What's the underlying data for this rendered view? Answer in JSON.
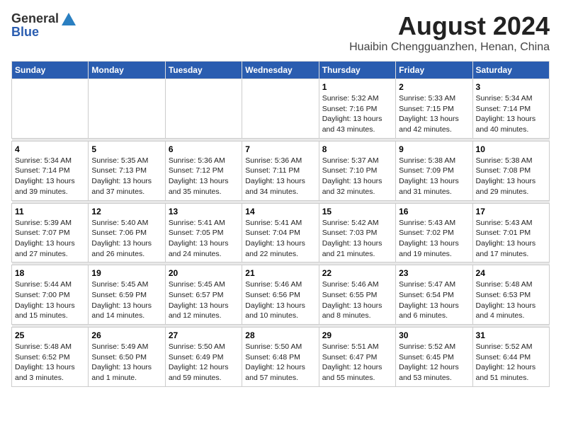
{
  "header": {
    "logo_general": "General",
    "logo_blue": "Blue",
    "title": "August 2024",
    "subtitle": "Huaibin Chengguanzhen, Henan, China"
  },
  "columns": [
    "Sunday",
    "Monday",
    "Tuesday",
    "Wednesday",
    "Thursday",
    "Friday",
    "Saturday"
  ],
  "weeks": [
    {
      "days": [
        {
          "num": "",
          "info": ""
        },
        {
          "num": "",
          "info": ""
        },
        {
          "num": "",
          "info": ""
        },
        {
          "num": "",
          "info": ""
        },
        {
          "num": "1",
          "info": "Sunrise: 5:32 AM\nSunset: 7:16 PM\nDaylight: 13 hours\nand 43 minutes."
        },
        {
          "num": "2",
          "info": "Sunrise: 5:33 AM\nSunset: 7:15 PM\nDaylight: 13 hours\nand 42 minutes."
        },
        {
          "num": "3",
          "info": "Sunrise: 5:34 AM\nSunset: 7:14 PM\nDaylight: 13 hours\nand 40 minutes."
        }
      ]
    },
    {
      "days": [
        {
          "num": "4",
          "info": "Sunrise: 5:34 AM\nSunset: 7:14 PM\nDaylight: 13 hours\nand 39 minutes."
        },
        {
          "num": "5",
          "info": "Sunrise: 5:35 AM\nSunset: 7:13 PM\nDaylight: 13 hours\nand 37 minutes."
        },
        {
          "num": "6",
          "info": "Sunrise: 5:36 AM\nSunset: 7:12 PM\nDaylight: 13 hours\nand 35 minutes."
        },
        {
          "num": "7",
          "info": "Sunrise: 5:36 AM\nSunset: 7:11 PM\nDaylight: 13 hours\nand 34 minutes."
        },
        {
          "num": "8",
          "info": "Sunrise: 5:37 AM\nSunset: 7:10 PM\nDaylight: 13 hours\nand 32 minutes."
        },
        {
          "num": "9",
          "info": "Sunrise: 5:38 AM\nSunset: 7:09 PM\nDaylight: 13 hours\nand 31 minutes."
        },
        {
          "num": "10",
          "info": "Sunrise: 5:38 AM\nSunset: 7:08 PM\nDaylight: 13 hours\nand 29 minutes."
        }
      ]
    },
    {
      "days": [
        {
          "num": "11",
          "info": "Sunrise: 5:39 AM\nSunset: 7:07 PM\nDaylight: 13 hours\nand 27 minutes."
        },
        {
          "num": "12",
          "info": "Sunrise: 5:40 AM\nSunset: 7:06 PM\nDaylight: 13 hours\nand 26 minutes."
        },
        {
          "num": "13",
          "info": "Sunrise: 5:41 AM\nSunset: 7:05 PM\nDaylight: 13 hours\nand 24 minutes."
        },
        {
          "num": "14",
          "info": "Sunrise: 5:41 AM\nSunset: 7:04 PM\nDaylight: 13 hours\nand 22 minutes."
        },
        {
          "num": "15",
          "info": "Sunrise: 5:42 AM\nSunset: 7:03 PM\nDaylight: 13 hours\nand 21 minutes."
        },
        {
          "num": "16",
          "info": "Sunrise: 5:43 AM\nSunset: 7:02 PM\nDaylight: 13 hours\nand 19 minutes."
        },
        {
          "num": "17",
          "info": "Sunrise: 5:43 AM\nSunset: 7:01 PM\nDaylight: 13 hours\nand 17 minutes."
        }
      ]
    },
    {
      "days": [
        {
          "num": "18",
          "info": "Sunrise: 5:44 AM\nSunset: 7:00 PM\nDaylight: 13 hours\nand 15 minutes."
        },
        {
          "num": "19",
          "info": "Sunrise: 5:45 AM\nSunset: 6:59 PM\nDaylight: 13 hours\nand 14 minutes."
        },
        {
          "num": "20",
          "info": "Sunrise: 5:45 AM\nSunset: 6:57 PM\nDaylight: 13 hours\nand 12 minutes."
        },
        {
          "num": "21",
          "info": "Sunrise: 5:46 AM\nSunset: 6:56 PM\nDaylight: 13 hours\nand 10 minutes."
        },
        {
          "num": "22",
          "info": "Sunrise: 5:46 AM\nSunset: 6:55 PM\nDaylight: 13 hours\nand 8 minutes."
        },
        {
          "num": "23",
          "info": "Sunrise: 5:47 AM\nSunset: 6:54 PM\nDaylight: 13 hours\nand 6 minutes."
        },
        {
          "num": "24",
          "info": "Sunrise: 5:48 AM\nSunset: 6:53 PM\nDaylight: 13 hours\nand 4 minutes."
        }
      ]
    },
    {
      "days": [
        {
          "num": "25",
          "info": "Sunrise: 5:48 AM\nSunset: 6:52 PM\nDaylight: 13 hours\nand 3 minutes."
        },
        {
          "num": "26",
          "info": "Sunrise: 5:49 AM\nSunset: 6:50 PM\nDaylight: 13 hours\nand 1 minute."
        },
        {
          "num": "27",
          "info": "Sunrise: 5:50 AM\nSunset: 6:49 PM\nDaylight: 12 hours\nand 59 minutes."
        },
        {
          "num": "28",
          "info": "Sunrise: 5:50 AM\nSunset: 6:48 PM\nDaylight: 12 hours\nand 57 minutes."
        },
        {
          "num": "29",
          "info": "Sunrise: 5:51 AM\nSunset: 6:47 PM\nDaylight: 12 hours\nand 55 minutes."
        },
        {
          "num": "30",
          "info": "Sunrise: 5:52 AM\nSunset: 6:45 PM\nDaylight: 12 hours\nand 53 minutes."
        },
        {
          "num": "31",
          "info": "Sunrise: 5:52 AM\nSunset: 6:44 PM\nDaylight: 12 hours\nand 51 minutes."
        }
      ]
    }
  ]
}
